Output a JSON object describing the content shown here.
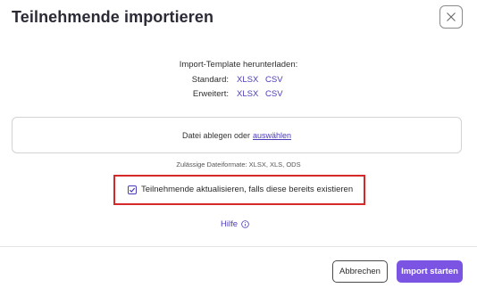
{
  "dialog": {
    "title": "Teilnehmende importieren",
    "close_icon": "close-icon"
  },
  "template": {
    "heading": "Import-Template herunterladen:",
    "rows": [
      {
        "label": "Standard:",
        "links": [
          "XLSX",
          "CSV"
        ]
      },
      {
        "label": "Erweitert:",
        "links": [
          "XLSX",
          "CSV"
        ]
      }
    ]
  },
  "dropzone": {
    "text": "Datei ablegen oder",
    "link": "auswählen"
  },
  "formats_text": "Zulässige Dateiformate: XLSX, XLS, ODS",
  "checkbox": {
    "label": "Teilnehmende aktualisieren, falls diese bereits existieren",
    "checked": true
  },
  "help": {
    "label": "Hilfe",
    "icon": "info-icon"
  },
  "footer": {
    "cancel_label": "Abbrechen",
    "start_label": "Import starten"
  },
  "colors": {
    "accent": "#7b54e3",
    "link": "#4a3bb8",
    "highlight": "#d62828"
  }
}
